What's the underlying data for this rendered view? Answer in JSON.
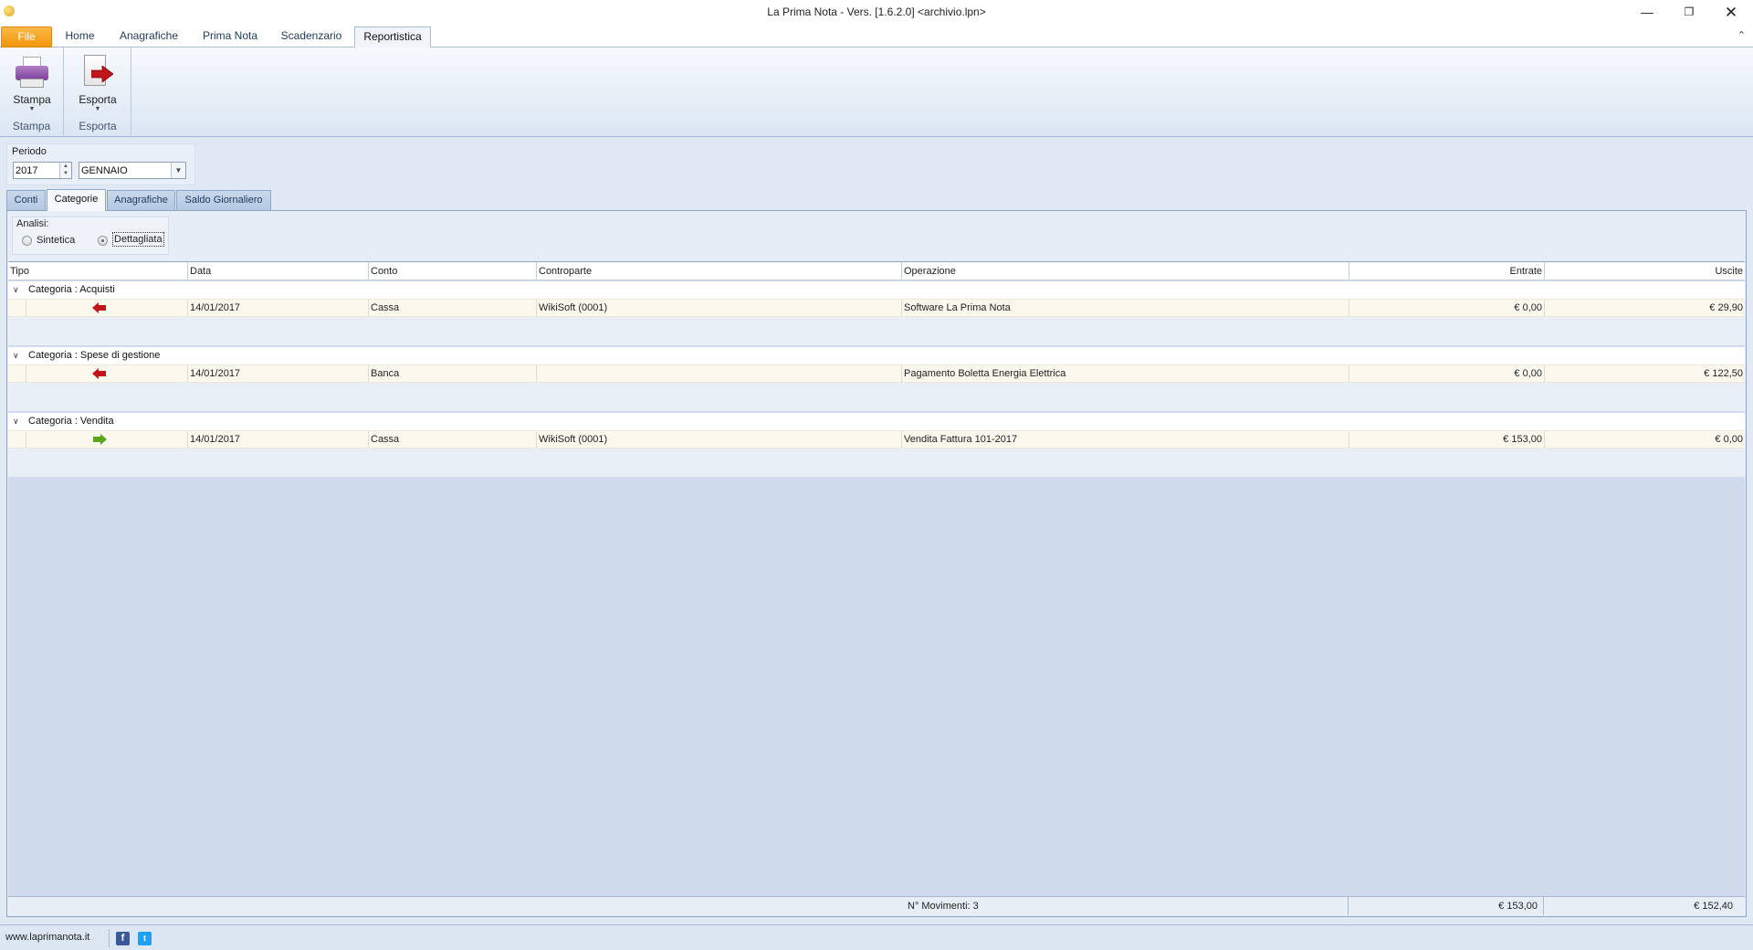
{
  "window": {
    "title": "La Prima Nota - Vers. [1.6.2.0] <archivio.lpn>",
    "minimize_icon": "minimize-icon",
    "maximize_icon": "restore-icon",
    "close_icon": "close-icon"
  },
  "ribbon": {
    "tabs": [
      {
        "label": "File"
      },
      {
        "label": "Home"
      },
      {
        "label": "Anagrafiche"
      },
      {
        "label": "Prima Nota"
      },
      {
        "label": "Scadenzario"
      },
      {
        "label": "Reportistica"
      }
    ],
    "active_tab": "Reportistica",
    "groups": {
      "stampa": {
        "button_label": "Stampa",
        "group_label": "Stampa",
        "icon": "printer-icon"
      },
      "esporta": {
        "button_label": "Esporta",
        "group_label": "Esporta",
        "icon": "export-icon"
      }
    }
  },
  "periodo": {
    "label": "Periodo",
    "year": "2017",
    "month": "GENNAIO"
  },
  "tabs": [
    {
      "label": "Conti"
    },
    {
      "label": "Categorie"
    },
    {
      "label": "Anagrafiche"
    },
    {
      "label": "Saldo Giornaliero"
    }
  ],
  "active_view_tab": "Categorie",
  "analisi": {
    "label": "Analisi:",
    "options": [
      {
        "label": "Sintetica",
        "checked": false
      },
      {
        "label": "Dettagliata",
        "checked": true
      }
    ]
  },
  "grid": {
    "columns": [
      "Tipo",
      "Data",
      "Conto",
      "Controparte",
      "Operazione",
      "Entrate",
      "Uscite"
    ],
    "groups": [
      {
        "title": "Categoria : Acquisti",
        "rows": [
          {
            "tipo": "uscita",
            "data": "14/01/2017",
            "conto": "Cassa",
            "controparte": "WikiSoft (0001)",
            "operazione": "Software La Prima Nota",
            "entrate": "€ 0,00",
            "uscite": "€ 29,90"
          }
        ]
      },
      {
        "title": "Categoria : Spese di gestione",
        "rows": [
          {
            "tipo": "uscita",
            "data": "14/01/2017",
            "conto": "Banca",
            "controparte": "",
            "operazione": "Pagamento Boletta Energia Elettrica",
            "entrate": "€ 0,00",
            "uscite": "€ 122,50"
          }
        ]
      },
      {
        "title": "Categoria : Vendita",
        "rows": [
          {
            "tipo": "entrata",
            "data": "14/01/2017",
            "conto": "Cassa",
            "controparte": "WikiSoft (0001)",
            "operazione": "Vendita Fattura 101-2017",
            "entrate": "€ 153,00",
            "uscite": "€ 0,00"
          }
        ]
      }
    ],
    "footer": {
      "movimenti": "N° Movimenti: 3",
      "totale_entrate": "€ 153,00",
      "totale_uscite": "€ 152,40"
    }
  },
  "colors": {
    "uscita_arrow": "#c0161b",
    "entrata_arrow": "#5aa61b",
    "file_tab": "#f2950d"
  },
  "statusbar": {
    "link": "www.laprimanota.it",
    "facebook_glyph": "f",
    "twitter_glyph": "t"
  }
}
